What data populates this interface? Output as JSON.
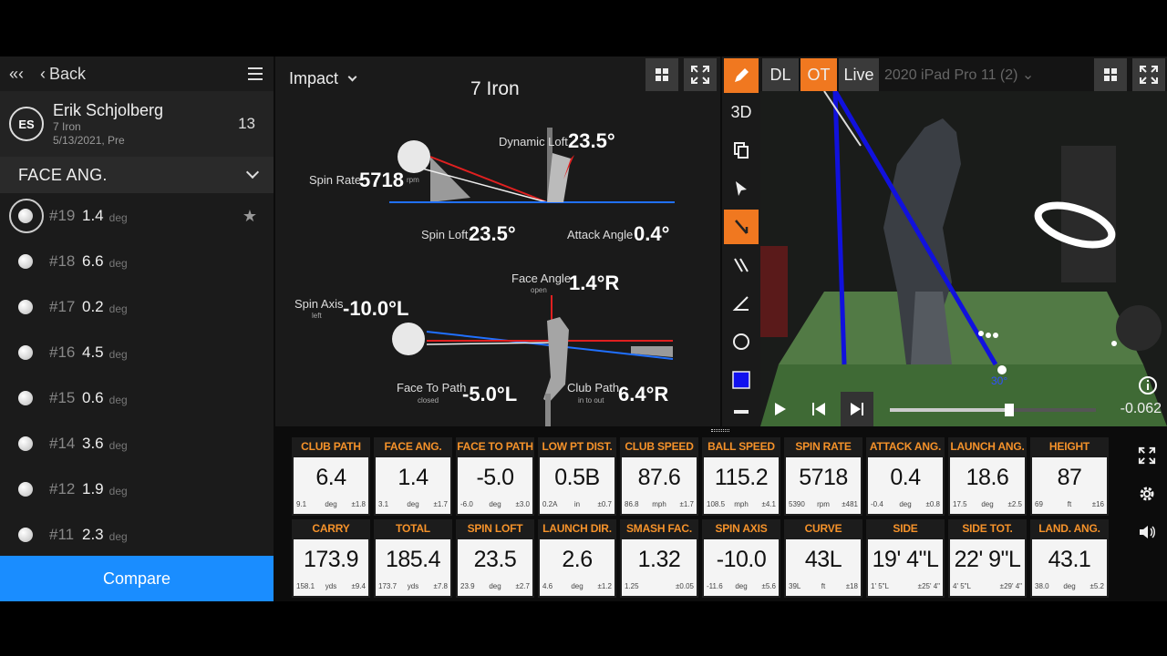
{
  "sidebar": {
    "double_back": "«‹",
    "back_label": "Back",
    "player": {
      "initials": "ES",
      "name": "Erik Schjolberg",
      "club": "7 Iron",
      "date": "5/13/2021, Pre",
      "count": "13"
    },
    "metric_label": "FACE ANG.",
    "shots": [
      {
        "num": "#19",
        "value": "1.4",
        "unit": "deg",
        "selected": true
      },
      {
        "num": "#18",
        "value": "6.6",
        "unit": "deg"
      },
      {
        "num": "#17",
        "value": "0.2",
        "unit": "deg"
      },
      {
        "num": "#16",
        "value": "4.5",
        "unit": "deg"
      },
      {
        "num": "#15",
        "value": "0.6",
        "unit": "deg"
      },
      {
        "num": "#14",
        "value": "3.6",
        "unit": "deg"
      },
      {
        "num": "#12",
        "value": "1.9",
        "unit": "deg"
      },
      {
        "num": "#11",
        "value": "2.3",
        "unit": "deg"
      }
    ],
    "compare_label": "Compare"
  },
  "impact": {
    "view_label": "Impact",
    "club": "7 Iron",
    "dynamic_loft_label": "Dynamic Loft",
    "dynamic_loft": "23.5°",
    "spin_rate_label": "Spin Rate",
    "spin_rate": "5718",
    "spin_rate_unit": "rpm",
    "spin_loft_label": "Spin Loft",
    "spin_loft": "23.5°",
    "attack_angle_label": "Attack Angle",
    "attack_angle": "0.4°",
    "face_angle_label": "Face Angle",
    "face_angle_sub": "open",
    "face_angle": "1.4°R",
    "spin_axis_label": "Spin Axis",
    "spin_axis_sub": "left",
    "spin_axis": "-10.0°L",
    "face_to_path_label": "Face To Path",
    "face_to_path_sub": "closed",
    "face_to_path": "-5.0°L",
    "club_path_label": "Club Path",
    "club_path_sub": "in to out",
    "club_path": "6.4°R"
  },
  "video": {
    "tabs": {
      "dl": "DL",
      "ot": "OT",
      "live": "Live"
    },
    "device": "2020 iPad Pro 11 (2) ⌄",
    "tools": {
      "three_d": "3D"
    },
    "angle_label": "30°",
    "time": "-0.062",
    "progress": 0.58
  },
  "stats": [
    {
      "name": "CLUB PATH",
      "value": "6.4",
      "min": "9.1",
      "unit": "deg",
      "sd": "±1.8"
    },
    {
      "name": "FACE ANG.",
      "value": "1.4",
      "min": "3.1",
      "unit": "deg",
      "sd": "±1.7"
    },
    {
      "name": "FACE TO PATH",
      "value": "-5.0",
      "min": "-6.0",
      "unit": "deg",
      "sd": "±3.0"
    },
    {
      "name": "LOW PT DIST.",
      "value": "0.5B",
      "min": "0.2A",
      "unit": "in",
      "sd": "±0.7"
    },
    {
      "name": "CLUB SPEED",
      "value": "87.6",
      "min": "86.8",
      "unit": "mph",
      "sd": "±1.7"
    },
    {
      "name": "BALL SPEED",
      "value": "115.2",
      "min": "108.5",
      "unit": "mph",
      "sd": "±4.1"
    },
    {
      "name": "SPIN RATE",
      "value": "5718",
      "min": "5390",
      "unit": "rpm",
      "sd": "±481"
    },
    {
      "name": "ATTACK ANG.",
      "value": "0.4",
      "min": "-0.4",
      "unit": "deg",
      "sd": "±0.8"
    },
    {
      "name": "LAUNCH ANG.",
      "value": "18.6",
      "min": "17.5",
      "unit": "deg",
      "sd": "±2.5"
    },
    {
      "name": "HEIGHT",
      "value": "87",
      "min": "69",
      "unit": "ft",
      "sd": "±16"
    },
    {
      "name": "CARRY",
      "value": "173.9",
      "min": "158.1",
      "unit": "yds",
      "sd": "±9.4"
    },
    {
      "name": "TOTAL",
      "value": "185.4",
      "min": "173.7",
      "unit": "yds",
      "sd": "±7.8"
    },
    {
      "name": "SPIN LOFT",
      "value": "23.5",
      "min": "23.9",
      "unit": "deg",
      "sd": "±2.7"
    },
    {
      "name": "LAUNCH DIR.",
      "value": "2.6",
      "min": "4.6",
      "unit": "deg",
      "sd": "±1.2"
    },
    {
      "name": "SMASH FAC.",
      "value": "1.32",
      "min": "1.25",
      "unit": "",
      "sd": "±0.05"
    },
    {
      "name": "SPIN AXIS",
      "value": "-10.0",
      "min": "-11.6",
      "unit": "deg",
      "sd": "±5.6"
    },
    {
      "name": "CURVE",
      "value": "43L",
      "min": "39L",
      "unit": "ft",
      "sd": "±18"
    },
    {
      "name": "SIDE",
      "value": "19' 4\"L",
      "min": "1' 5\"L",
      "unit": "",
      "sd": "±25' 4\""
    },
    {
      "name": "SIDE TOT.",
      "value": "22' 9\"L",
      "min": "4' 5\"L",
      "unit": "",
      "sd": "±29' 4\""
    },
    {
      "name": "LAND. ANG.",
      "value": "43.1",
      "min": "38.0",
      "unit": "deg",
      "sd": "±5.2"
    }
  ],
  "colors": {
    "accent": "#f07820",
    "compare": "#1a8dff",
    "stat_header": "#f5922a",
    "line_blue": "#1111dd",
    "red": "#e02020"
  },
  "icons": [
    "menu-icon",
    "grid-icon",
    "fullscreen-icon",
    "pencil-icon",
    "copy-icon",
    "pointer-icon",
    "line-tool-icon",
    "parallel-lines-icon",
    "angle-icon",
    "circle-icon",
    "color-swatch-icon",
    "play-icon",
    "skip-back-icon",
    "step-forward-icon",
    "info-icon",
    "settings-icon",
    "volume-icon"
  ]
}
